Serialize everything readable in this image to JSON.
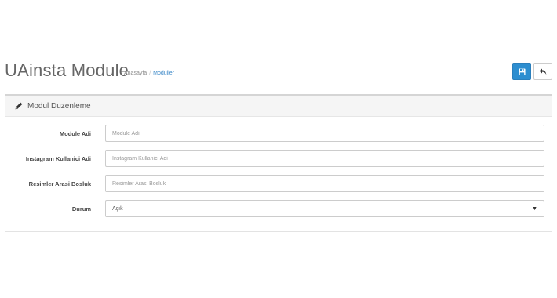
{
  "header": {
    "title": "UAinsta Module",
    "breadcrumb": {
      "home": "Anasayfa",
      "separator": "/",
      "current": "Moduller"
    },
    "buttons": {
      "save_icon": "floppy-disk-icon",
      "back_icon": "reply-arrow-icon"
    }
  },
  "panel": {
    "icon": "pencil-icon",
    "title": "Modul Duzenleme",
    "fields": [
      {
        "label": "Module Adi",
        "placeholder": "Module Adi",
        "value": ""
      },
      {
        "label": "Instagram Kullanici Adi",
        "placeholder": "Instagram Kullanici Adi",
        "value": ""
      },
      {
        "label": "Resimler Arasi Bosluk",
        "placeholder": "Resimler Arasi Bosluk",
        "value": ""
      }
    ],
    "status": {
      "label": "Durum",
      "selected": "Açık"
    }
  },
  "colors": {
    "primary": "#2d8ed0",
    "link": "#3a87c7",
    "panel_heading_bg": "#f5f5f5"
  }
}
